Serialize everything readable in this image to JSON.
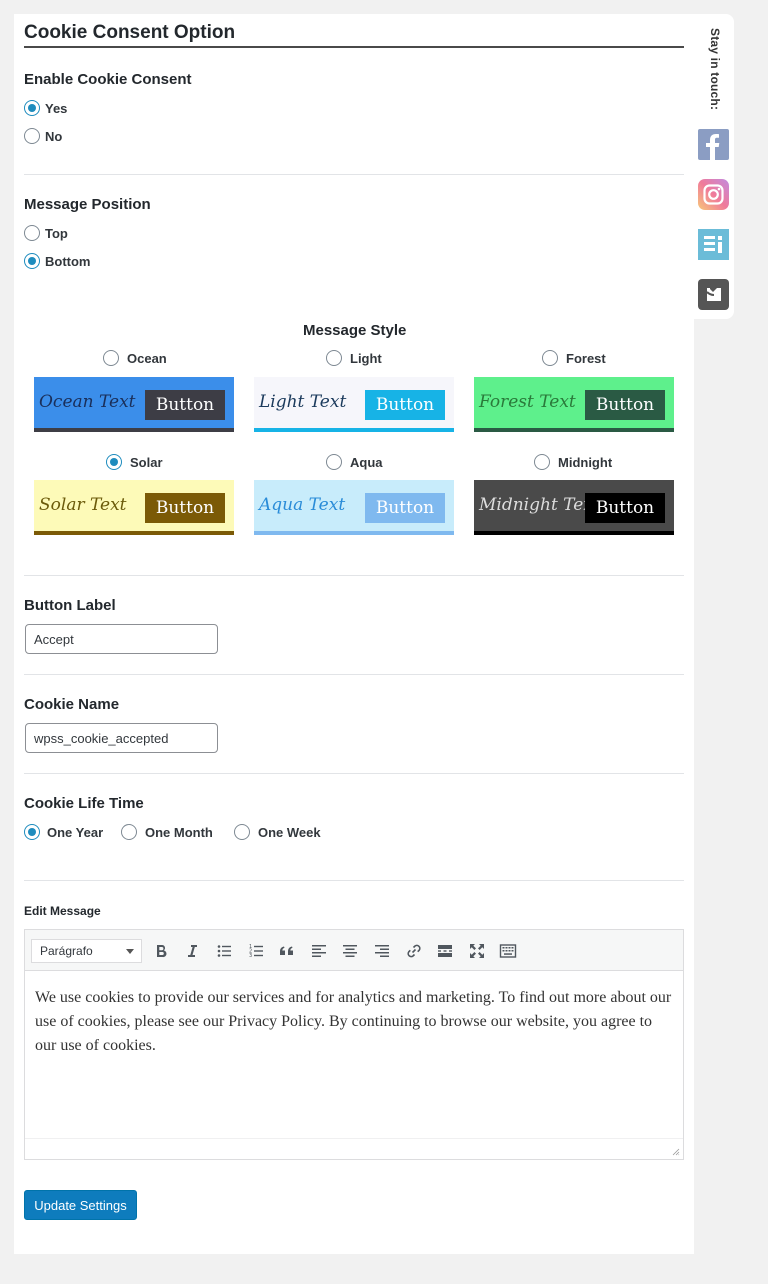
{
  "header": {
    "title": "Cookie Consent Option"
  },
  "enable": {
    "label": "Enable Cookie Consent",
    "options": [
      {
        "label": "Yes",
        "checked": true
      },
      {
        "label": "No",
        "checked": false
      }
    ]
  },
  "position": {
    "label": "Message Position",
    "options": [
      {
        "label": "Top",
        "checked": false
      },
      {
        "label": "Bottom",
        "checked": true
      }
    ]
  },
  "style": {
    "label": "Message Style",
    "options": [
      {
        "label": "Ocean",
        "checked": false,
        "text": "Ocean Text",
        "button": "Button",
        "bg": "#3b8eea",
        "text_color": "#1a2f5a",
        "btn_bg": "#3d3d45",
        "btn_color": "#ffffff",
        "bar": "#3d3d45"
      },
      {
        "label": "Light",
        "checked": false,
        "text": "Light Text",
        "button": "Button",
        "bg": "#f6f6fb",
        "text_color": "#1b3a5c",
        "btn_bg": "#17b3e6",
        "btn_color": "#ffffff",
        "bar": "#17b3e6"
      },
      {
        "label": "Forest",
        "checked": false,
        "text": "Forest Text",
        "button": "Button",
        "bg": "#5ef08c",
        "text_color": "#2a7a3a",
        "btn_bg": "#2a5a44",
        "btn_color": "#ffffff",
        "bar": "#2a5a44"
      },
      {
        "label": "Solar",
        "checked": true,
        "text": "Solar Text",
        "button": "Button",
        "bg": "#fdfab8",
        "text_color": "#6b5a0a",
        "btn_bg": "#7b5a06",
        "btn_color": "#ffffff",
        "bar": "#7b5a06"
      },
      {
        "label": "Aqua",
        "checked": false,
        "text": "Aqua Text",
        "button": "Button",
        "bg": "#c8ecfb",
        "text_color": "#2a8cd8",
        "btn_bg": "#7fb9ef",
        "btn_color": "#ffffff",
        "bar": "#7fb9ef"
      },
      {
        "label": "Midnight",
        "checked": false,
        "text": "Midnight Text",
        "button": "Button",
        "bg": "#4a4a4a",
        "text_color": "#dcdcdc",
        "btn_bg": "#000000",
        "btn_color": "#ffffff",
        "bar": "#000000"
      }
    ]
  },
  "button_label": {
    "label": "Button Label",
    "value": "Accept"
  },
  "cookie_name": {
    "label": "Cookie Name",
    "value": "wpss_cookie_accepted"
  },
  "lifetime": {
    "label": "Cookie Life Time",
    "options": [
      {
        "label": "One Year",
        "checked": true
      },
      {
        "label": "One Month",
        "checked": false
      },
      {
        "label": "One Week",
        "checked": false
      }
    ]
  },
  "editor": {
    "label": "Edit Message",
    "format": "Parágrafo",
    "content": "We use cookies to provide our services and for analytics and marketing. To find out more about our use of cookies, please see our Privacy Policy. By continuing to browse our website, you agree to our use of cookies.",
    "toolbar_icons": [
      "bold-icon",
      "italic-icon",
      "bullet-list-icon",
      "numbered-list-icon",
      "blockquote-icon",
      "align-left-icon",
      "align-center-icon",
      "align-right-icon",
      "link-icon",
      "read-more-icon",
      "fullscreen-icon",
      "toolbar-toggle-icon"
    ]
  },
  "submit": {
    "label": "Update Settings"
  },
  "sidebar": {
    "label": "Stay in touch:",
    "icons": [
      "facebook-icon",
      "instagram-icon",
      "wordpress-icon",
      "website-icon"
    ],
    "colors": {
      "facebook": "#8b9dc3",
      "instagram": "#f07a9a",
      "wordpress": "#6bbcd8",
      "website": "#555555"
    }
  },
  "colors": {
    "accent": "#1e8cbe",
    "primary_button": "#0e7cbd"
  }
}
